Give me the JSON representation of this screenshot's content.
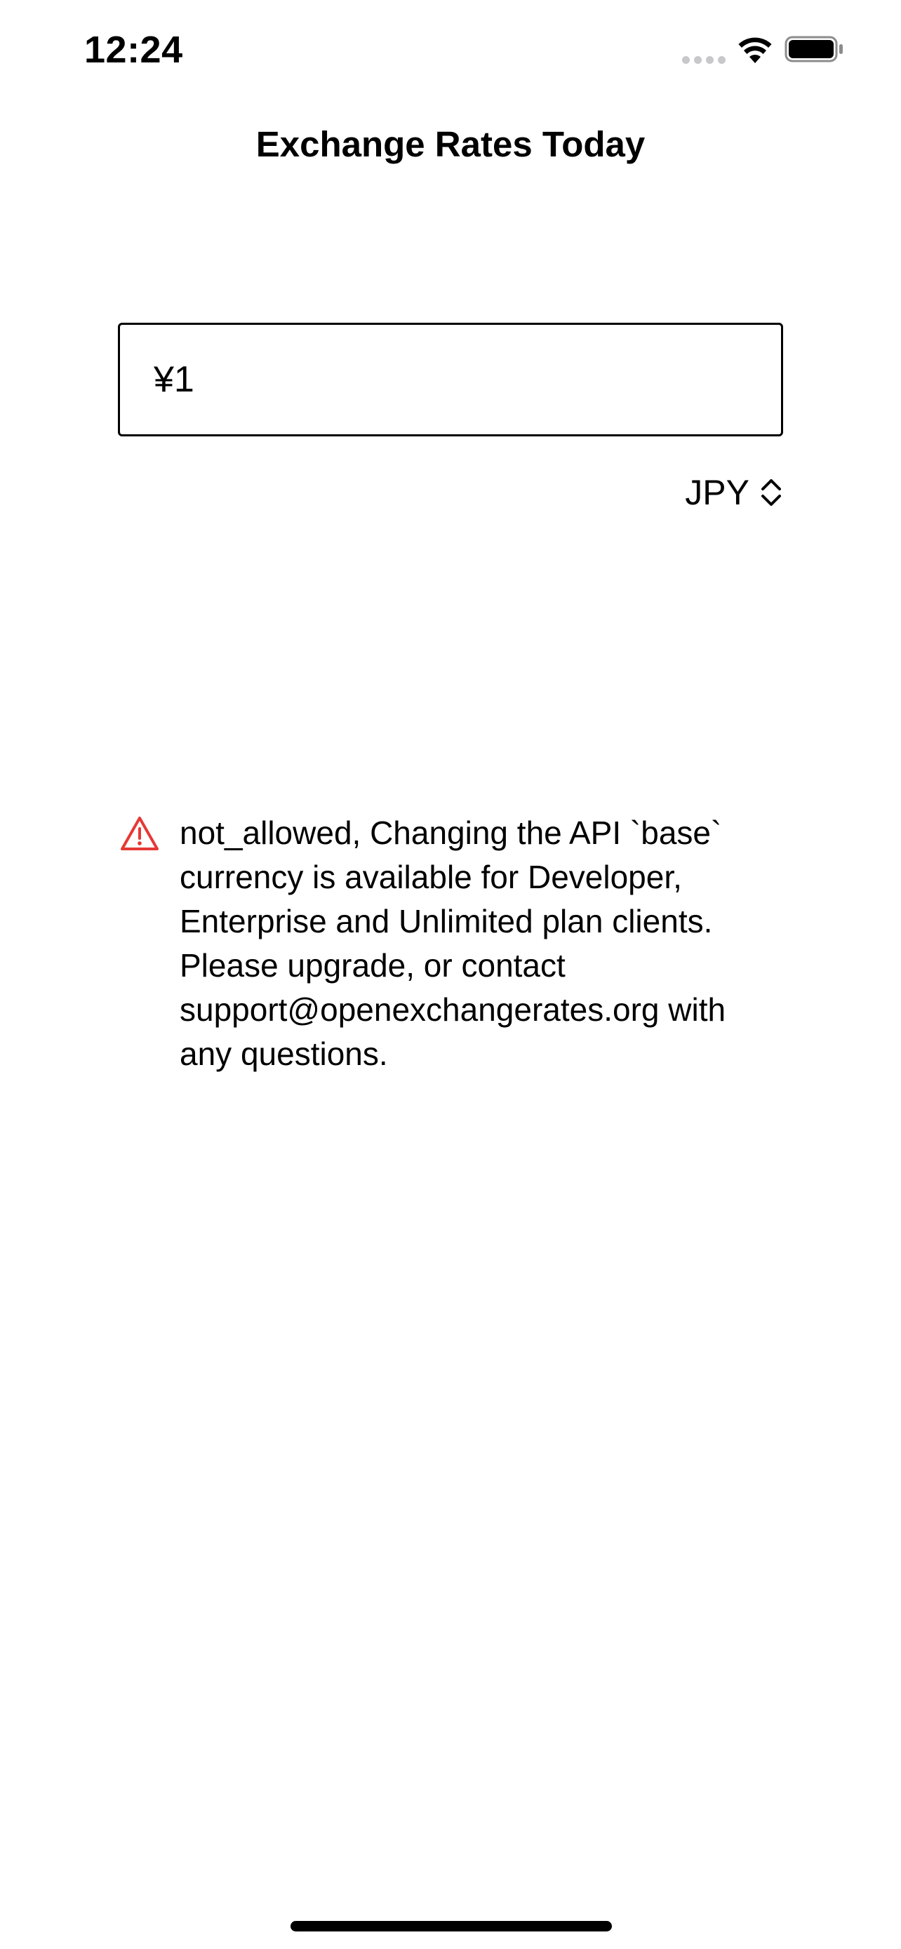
{
  "status_bar": {
    "time": "12:24",
    "icons": [
      "signal-dots-icon",
      "wifi-icon",
      "battery-icon"
    ]
  },
  "nav": {
    "title": "Exchange Rates Today"
  },
  "amount_input": {
    "value": "¥1",
    "placeholder": ""
  },
  "currency_picker": {
    "selected": "JPY",
    "icon": "chevron-up-down-icon"
  },
  "error": {
    "icon": "warning-icon",
    "message": "not_allowed, Changing the API `base` currency is available for Developer, Enterprise and Unlimited plan clients. Please upgrade, or contact support@openexchangerates.org with any questions."
  },
  "colors": {
    "warning": "#e53935",
    "text": "#000000",
    "background": "#ffffff",
    "signal_inactive": "#c7c7cc"
  }
}
